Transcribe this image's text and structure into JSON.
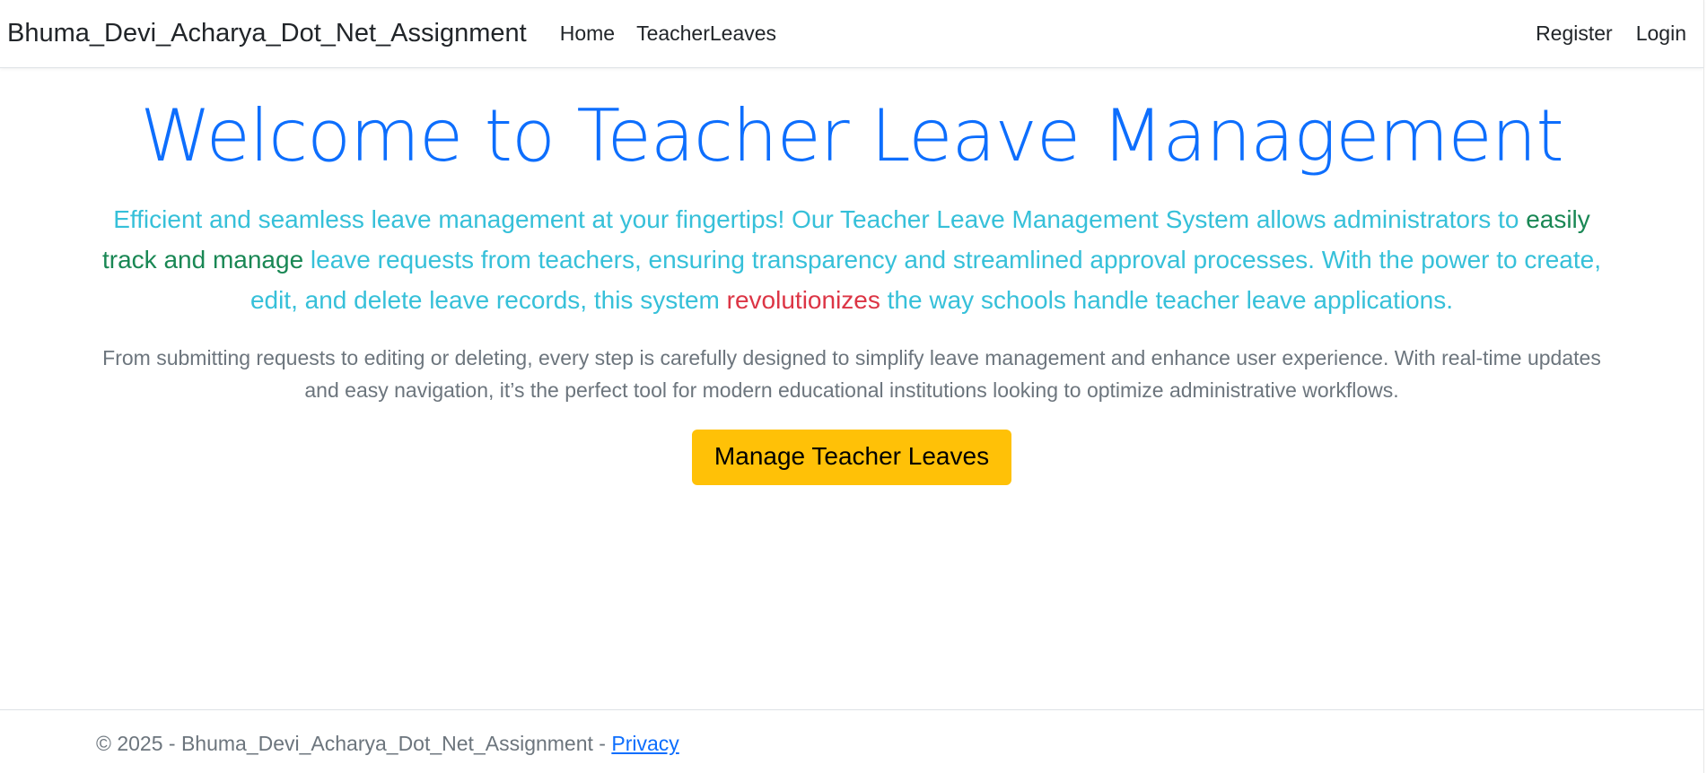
{
  "navbar": {
    "brand": "Bhuma_Devi_Acharya_Dot_Net_Assignment",
    "left_links": [
      "Home",
      "TeacherLeaves"
    ],
    "right_links": [
      "Register",
      "Login"
    ]
  },
  "main": {
    "heading": "Welcome to Teacher Leave Management",
    "lead_part1": "Efficient and seamless leave management at your fingertips! Our Teacher Leave Management System allows administrators to ",
    "lead_highlight_green": "easily track and manage",
    "lead_part2": " leave requests from teachers, ensuring transparency and streamlined approval processes. With the power to create, edit, and delete leave records, this system ",
    "lead_highlight_red": "revolutionizes",
    "lead_part3": " the way schools handle teacher leave applications.",
    "description": "From submitting requests to editing or deleting, every step is carefully designed to simplify leave management and enhance user experience. With real-time updates and easy navigation, it’s the perfect tool for modern educational institutions looking to optimize administrative workflows.",
    "cta_button": "Manage Teacher Leaves"
  },
  "footer": {
    "copyright": "© 2025 - Bhuma_Devi_Acharya_Dot_Net_Assignment - ",
    "privacy_link": "Privacy"
  },
  "colors": {
    "primary": "#0d6efd",
    "info": "#36c0d9",
    "success": "#198754",
    "danger": "#dc3545",
    "warning": "#ffc107",
    "muted": "#6c757d"
  }
}
